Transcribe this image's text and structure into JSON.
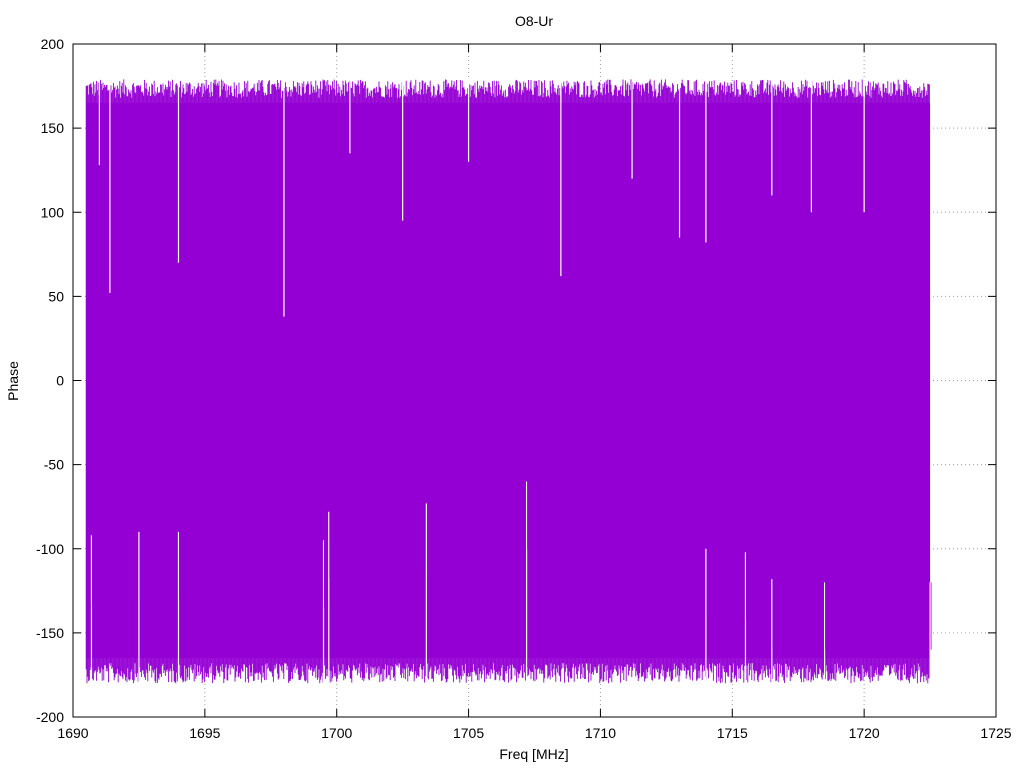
{
  "chart_data": {
    "type": "line",
    "title": "O8-Ur",
    "xlabel": "Freq [MHz]",
    "ylabel": "Phase",
    "xlim": [
      1690,
      1725
    ],
    "ylim": [
      -200,
      200
    ],
    "xticks": [
      1690,
      1695,
      1700,
      1705,
      1710,
      1715,
      1720,
      1725
    ],
    "yticks": [
      -200,
      -150,
      -100,
      -50,
      0,
      50,
      100,
      150,
      200
    ],
    "xtick_labels": [
      "1690",
      "1695",
      "1700",
      "1705",
      "1710",
      "1715",
      "1720",
      "1725"
    ],
    "ytick_labels": [
      "-200",
      "-150",
      "-100",
      "-50",
      "0",
      "50",
      "100",
      "150",
      "200"
    ],
    "grid": true,
    "legend": "none",
    "series_color": "#9400d3",
    "series": [
      {
        "x_range": [
          1690.5,
          1722.5
        ],
        "y_range": [
          -180,
          180
        ],
        "points": [
          [
            1690.5,
            120
          ],
          [
            1690.5,
            -155
          ],
          [
            1690.6,
            175
          ],
          [
            1690.6,
            -178
          ],
          [
            1690.8,
            170
          ],
          [
            1690.8,
            -176
          ],
          [
            1691.0,
            128
          ],
          [
            1691.0,
            -92
          ],
          [
            1691.4,
            52
          ],
          [
            1691.4,
            -170
          ],
          [
            1692.0,
            175
          ],
          [
            1692.0,
            -120
          ],
          [
            1692.5,
            178
          ],
          [
            1692.5,
            -90
          ],
          [
            1693.0,
            172
          ],
          [
            1693.0,
            -170
          ],
          [
            1693.5,
            176
          ],
          [
            1693.5,
            -175
          ],
          [
            1694.0,
            70
          ],
          [
            1694.0,
            -90
          ],
          [
            1694.5,
            178
          ],
          [
            1694.5,
            -178
          ],
          [
            1695.0,
            175
          ],
          [
            1695.0,
            -170
          ],
          [
            1695.5,
            168
          ],
          [
            1695.5,
            -160
          ],
          [
            1696.0,
            176
          ],
          [
            1696.0,
            -120
          ],
          [
            1696.5,
            174
          ],
          [
            1696.5,
            -100
          ],
          [
            1697.0,
            178
          ],
          [
            1697.0,
            -176
          ],
          [
            1697.5,
            172
          ],
          [
            1697.5,
            -178
          ],
          [
            1698.0,
            38
          ],
          [
            1698.0,
            -130
          ],
          [
            1698.5,
            176
          ],
          [
            1698.5,
            -178
          ],
          [
            1699.0,
            178
          ],
          [
            1699.0,
            -170
          ],
          [
            1699.5,
            175
          ],
          [
            1699.5,
            -95
          ],
          [
            1699.7,
            170
          ],
          [
            1699.7,
            -78
          ],
          [
            1700.0,
            178
          ],
          [
            1700.0,
            -176
          ],
          [
            1700.5,
            176
          ],
          [
            1700.5,
            -178
          ],
          [
            1701.0,
            172
          ],
          [
            1701.0,
            -170
          ],
          [
            1701.5,
            178
          ],
          [
            1701.5,
            -176
          ],
          [
            1702.0,
            174
          ],
          [
            1702.0,
            -176
          ],
          [
            1702.5,
            95
          ],
          [
            1702.5,
            -150
          ],
          [
            1703.0,
            176
          ],
          [
            1703.0,
            -176
          ],
          [
            1703.4,
            170
          ],
          [
            1703.4,
            -73
          ],
          [
            1704.0,
            178
          ],
          [
            1704.0,
            -176
          ],
          [
            1704.5,
            172
          ],
          [
            1704.5,
            -178
          ],
          [
            1705.0,
            176
          ],
          [
            1705.0,
            -178
          ],
          [
            1705.5,
            178
          ],
          [
            1705.5,
            -176
          ],
          [
            1706.0,
            170
          ],
          [
            1706.0,
            -176
          ],
          [
            1706.5,
            176
          ],
          [
            1706.5,
            -178
          ],
          [
            1707.0,
            172
          ],
          [
            1707.0,
            -170
          ],
          [
            1707.2,
            174
          ],
          [
            1707.2,
            -60
          ],
          [
            1707.5,
            178
          ],
          [
            1707.5,
            -176
          ],
          [
            1708.0,
            176
          ],
          [
            1708.0,
            -178
          ],
          [
            1708.5,
            62
          ],
          [
            1708.5,
            -160
          ],
          [
            1709.0,
            178
          ],
          [
            1709.0,
            -176
          ],
          [
            1709.5,
            174
          ],
          [
            1709.5,
            -178
          ],
          [
            1710.0,
            176
          ],
          [
            1710.0,
            -176
          ],
          [
            1710.5,
            178
          ],
          [
            1710.5,
            -178
          ],
          [
            1711.0,
            172
          ],
          [
            1711.0,
            -170
          ],
          [
            1711.5,
            176
          ],
          [
            1711.5,
            -176
          ],
          [
            1712.0,
            178
          ],
          [
            1712.0,
            -174
          ],
          [
            1712.5,
            174
          ],
          [
            1712.5,
            -178
          ],
          [
            1713.0,
            85
          ],
          [
            1713.0,
            -176
          ],
          [
            1713.5,
            176
          ],
          [
            1713.5,
            -170
          ],
          [
            1714.0,
            82
          ],
          [
            1714.0,
            -100
          ],
          [
            1714.5,
            178
          ],
          [
            1714.5,
            -176
          ],
          [
            1715.0,
            174
          ],
          [
            1715.0,
            -178
          ],
          [
            1715.5,
            176
          ],
          [
            1715.5,
            -102
          ],
          [
            1716.0,
            178
          ],
          [
            1716.0,
            -176
          ],
          [
            1716.5,
            172
          ],
          [
            1716.5,
            -178
          ],
          [
            1717.0,
            176
          ],
          [
            1717.0,
            -115
          ],
          [
            1717.5,
            178
          ],
          [
            1717.5,
            -176
          ],
          [
            1718.0,
            100
          ],
          [
            1718.0,
            -178
          ],
          [
            1718.5,
            174
          ],
          [
            1718.5,
            -120
          ],
          [
            1719.0,
            176
          ],
          [
            1719.0,
            -176
          ],
          [
            1719.5,
            178
          ],
          [
            1719.5,
            -178
          ],
          [
            1720.0,
            100
          ],
          [
            1720.0,
            -176
          ],
          [
            1720.5,
            176
          ],
          [
            1720.5,
            -178
          ],
          [
            1721.0,
            178
          ],
          [
            1721.0,
            -175
          ],
          [
            1721.5,
            172
          ],
          [
            1721.5,
            -178
          ],
          [
            1722.0,
            178
          ],
          [
            1722.0,
            -176
          ],
          [
            1722.5,
            179
          ],
          [
            1722.5,
            -120
          ]
        ]
      }
    ]
  }
}
